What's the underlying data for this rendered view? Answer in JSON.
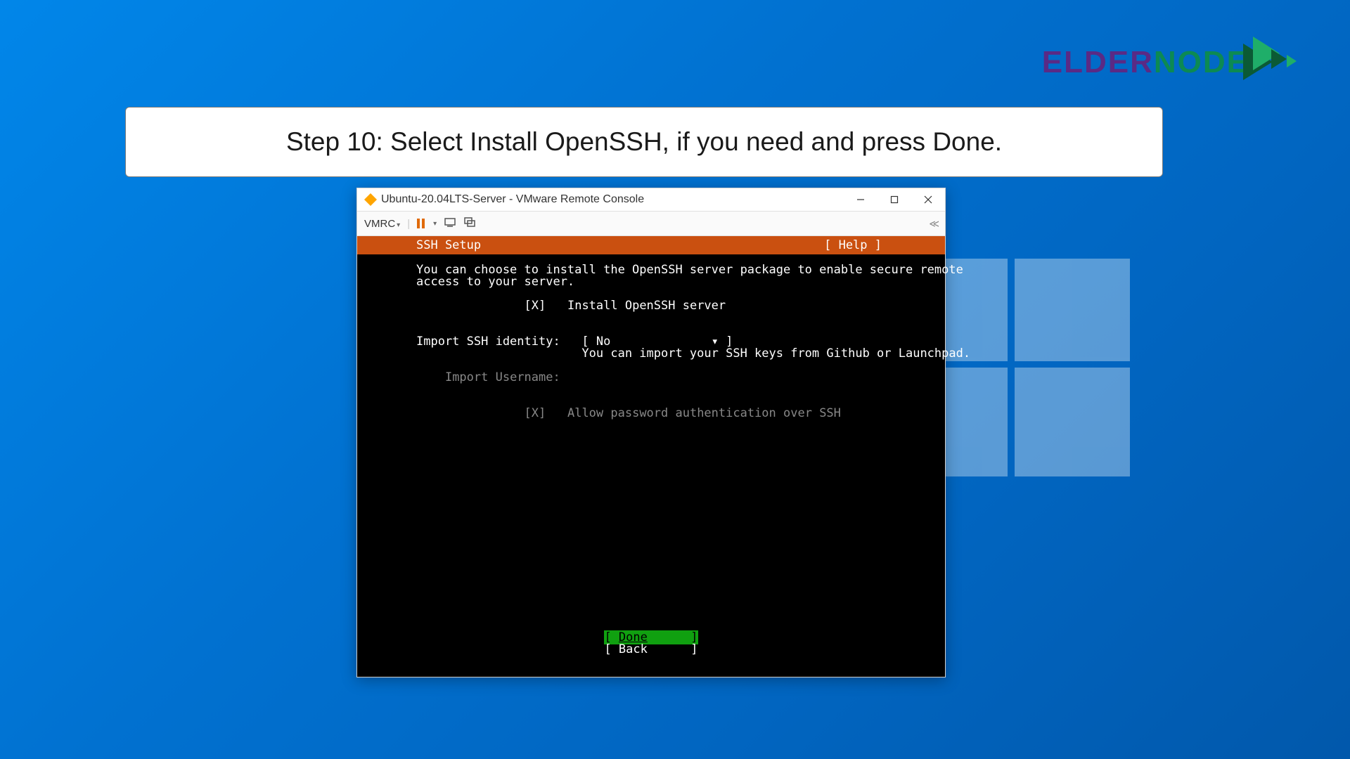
{
  "brand": {
    "part1": "ELDER",
    "part2": "NODE"
  },
  "instruction": "Step 10: Select Install OpenSSH, if you need and press Done.",
  "window": {
    "title": "Ubuntu-20.04LTS-Server - VMware Remote Console",
    "toolbar": {
      "menu_label": "VMRC"
    }
  },
  "console": {
    "header_title": "SSH Setup",
    "header_help": "[ Help ]",
    "description_line1": "You can choose to install the OpenSSH server package to enable secure remote",
    "description_line2": "access to your server.",
    "install_checkbox_mark": "[X]",
    "install_label": "Install OpenSSH server",
    "import_identity_label": "Import SSH identity:",
    "import_identity_value": "[ No              ▾ ]",
    "import_hint": "You can import your SSH keys from Github or Launchpad.",
    "import_username_label": "Import Username:",
    "allow_pw_checkbox_mark": "[X]",
    "allow_pw_label": "Allow password authentication over SSH",
    "done_label": "Done",
    "back_label": "Back"
  }
}
